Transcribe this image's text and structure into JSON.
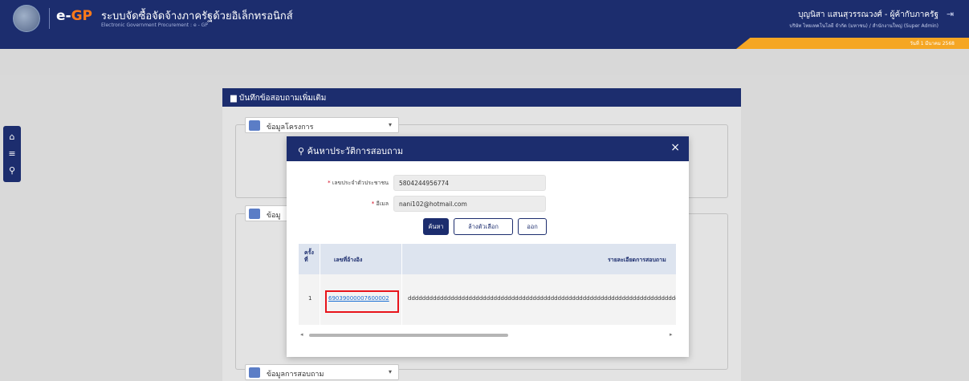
{
  "header": {
    "logo_prefix": "e-",
    "logo_gp": "GP",
    "system_title": "ระบบจัดซื้อจัดจ้างภาครัฐด้วยอิเล็กทรอนิกส์",
    "system_subtitle": "Electronic Government Procurement : e - GP",
    "user_name": "บุญนิสา แสนสุวรรณวงศ์ - ผู้ค้ากับภาครัฐ",
    "user_org": "บริษัท ไทยเทคโนโลยี จำกัด (มหาชน) / สำนักงานใหญ่ (Super Admin)",
    "stripe_text": "วันที่ 1 มีนาคม 2568"
  },
  "side_menu": {
    "home_icon": "home-icon",
    "menu_icon": "menu-icon",
    "search_icon": "search-icon"
  },
  "form": {
    "card_title": "บันทึกข้อสอบถามเพิ่มเติม",
    "section_project": "ข้อมูลโครงการ",
    "section_second": "ข้อมู",
    "section_question": "ข้อมูลการสอบถาม"
  },
  "modal": {
    "title": "ค้นหาประวัติการสอบถาม",
    "close_label": "×",
    "tax_label": "เลขประจำตัวประชาชน",
    "tax_value": "5804244956774",
    "email_label": "อีเมล",
    "email_value": "nani102@hotmail.com",
    "search_label": "ค้นหา",
    "clear_label": "ล้างตัวเลือก",
    "exit_label": "ออก"
  },
  "table": {
    "headers": [
      "ครั้งที่",
      "เลขที่อ้างอิง",
      "รายละเอียดการสอบถาม"
    ],
    "rows": [
      {
        "no": "1",
        "ref": "69039000007600002",
        "detail": "ddddddddddddddddddddddddddddddddddddddddddddddddddddddddddddddddddddddddddddddd"
      }
    ]
  },
  "colors": {
    "navy": "#1c2d6e",
    "orange": "#f5a623",
    "link": "#1a6fd4",
    "highlight": "#e8141b"
  }
}
